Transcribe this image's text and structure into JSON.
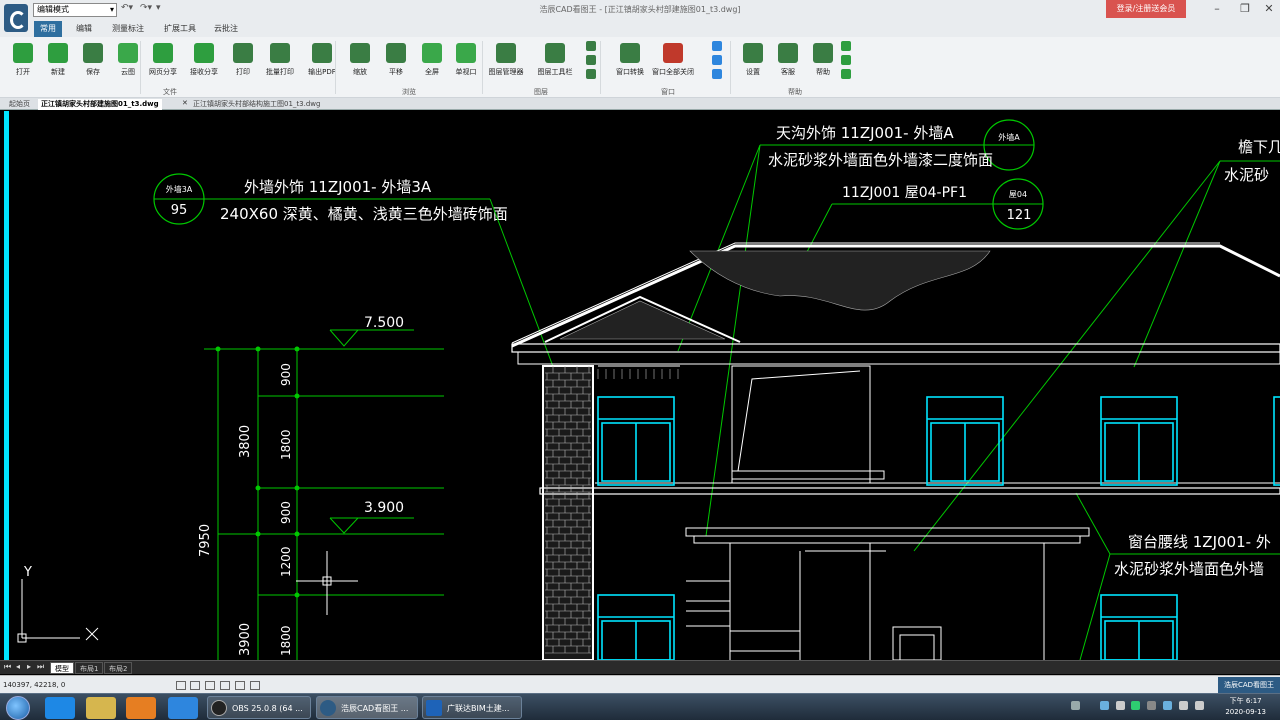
{
  "window": {
    "mode_select": "编辑模式",
    "title": "浩辰CAD看图王 - [正江镇胡家头村部建施图01_t3.dwg]",
    "login_button": "登录/注册送会员"
  },
  "menu": [
    "常用",
    "编辑",
    "测量标注",
    "扩展工具",
    "云批注"
  ],
  "ribbon": {
    "buttons": [
      {
        "label": "打开",
        "icon": "open-folder-icon",
        "color": "#2e9e3f"
      },
      {
        "label": "新建",
        "icon": "new-file-icon",
        "color": "#2e9e3f"
      },
      {
        "label": "保存",
        "icon": "save-icon",
        "color": "#3a7d44"
      },
      {
        "label": "云图",
        "icon": "cloud-icon",
        "color": "#3aa84a"
      },
      {
        "label": "网页分享",
        "icon": "web-share-icon",
        "color": "#2e9e3f"
      },
      {
        "label": "接收分享",
        "icon": "receive-share-icon",
        "color": "#2e9e3f"
      },
      {
        "label": "打印",
        "icon": "print-icon",
        "color": "#3a7d44"
      },
      {
        "label": "批量打印",
        "icon": "batch-print-icon",
        "color": "#3a7d44"
      },
      {
        "label": "输出PDF",
        "icon": "export-pdf-icon",
        "color": "#3a7d44"
      },
      {
        "label": "缩放",
        "icon": "zoom-icon",
        "color": "#3a7d44"
      },
      {
        "label": "平移",
        "icon": "pan-hand-icon",
        "color": "#3a7d44"
      },
      {
        "label": "全屏",
        "icon": "fullscreen-icon",
        "color": "#3aa84a"
      },
      {
        "label": "单视口",
        "icon": "single-viewport-icon",
        "color": "#3aa84a"
      },
      {
        "label": "图层管理器",
        "icon": "layer-manager-icon",
        "color": "#3a7d44"
      },
      {
        "label": "图层工具栏",
        "icon": "layer-toolbar-icon",
        "color": "#3a7d44"
      },
      {
        "label": "窗口转换",
        "icon": "window-switch-icon",
        "color": "#3a7d44"
      },
      {
        "label": "窗口全部关闭",
        "icon": "close-all-windows-icon",
        "color": "#c0392b"
      },
      {
        "label": "设置",
        "icon": "settings-gear-icon",
        "color": "#3a7d44"
      },
      {
        "label": "客服",
        "icon": "customer-service-icon",
        "color": "#3a7d44"
      },
      {
        "label": "帮助",
        "icon": "help-icon",
        "color": "#3a7d44"
      }
    ],
    "groups": [
      "文件",
      "浏览",
      "图层",
      "窗口",
      "帮助"
    ]
  },
  "doc_tabs": [
    "起始页",
    "正江镇胡家头村部建施图01_t3.dwg",
    "正江镇胡家头村部结构施工图01_t3.dwg"
  ],
  "drawing": {
    "ann1_line1": "外墙外饰 11ZJ001- 外墙3A",
    "ann1_line2": "240X60 深黄、橘黄、浅黄三色外墙砖饰面",
    "ann1_tag_top": "外墙3A",
    "ann1_tag_bottom": "95",
    "ann2_line1": "天沟外饰 11ZJ001- 外墙A",
    "ann2_line2": "水泥砂浆外墙面色外墙漆二度饰面",
    "ann2_tag_top": "外墙A",
    "ann3_line1": "11ZJ001 屋04-PF1",
    "ann3_tag_top": "屋04",
    "ann3_tag_bottom": "121",
    "ann4_line1": "檐下几",
    "ann4_line2": "水泥砂",
    "ann5_line1": "窗台腰线 1ZJ001- 外",
    "ann5_line2": "水泥砂浆外墙面色外墙",
    "elev1": "7.500",
    "elev2": "3.900",
    "dim_total": "7950",
    "dim_3800": "3800",
    "dim_3900": "3900",
    "dim_900a": "900",
    "dim_1800a": "1800",
    "dim_900b": "900",
    "dim_1200": "1200",
    "dim_1800b": "1800",
    "ucs_y": "Y",
    "ucs_x": "X"
  },
  "layout_tabs": [
    "模型",
    "布局1",
    "布局2"
  ],
  "status": {
    "coords": "140397, 42218, 0",
    "right_label": "浩辰CAD看图王"
  },
  "taskbar": {
    "apps": [
      {
        "label": "OBS 25.0.8 (64 ...",
        "color": "#222"
      },
      {
        "label": "浩辰CAD看图王 ...",
        "color": "#2d5b84"
      },
      {
        "label": "广联达BIM土建...",
        "color": "#1e63b8"
      }
    ],
    "time": "下午 6:17",
    "date": "2020-09-13"
  },
  "colors": {
    "cyan": "#00e5ff",
    "green": "#00c800",
    "white": "#ffffff"
  }
}
